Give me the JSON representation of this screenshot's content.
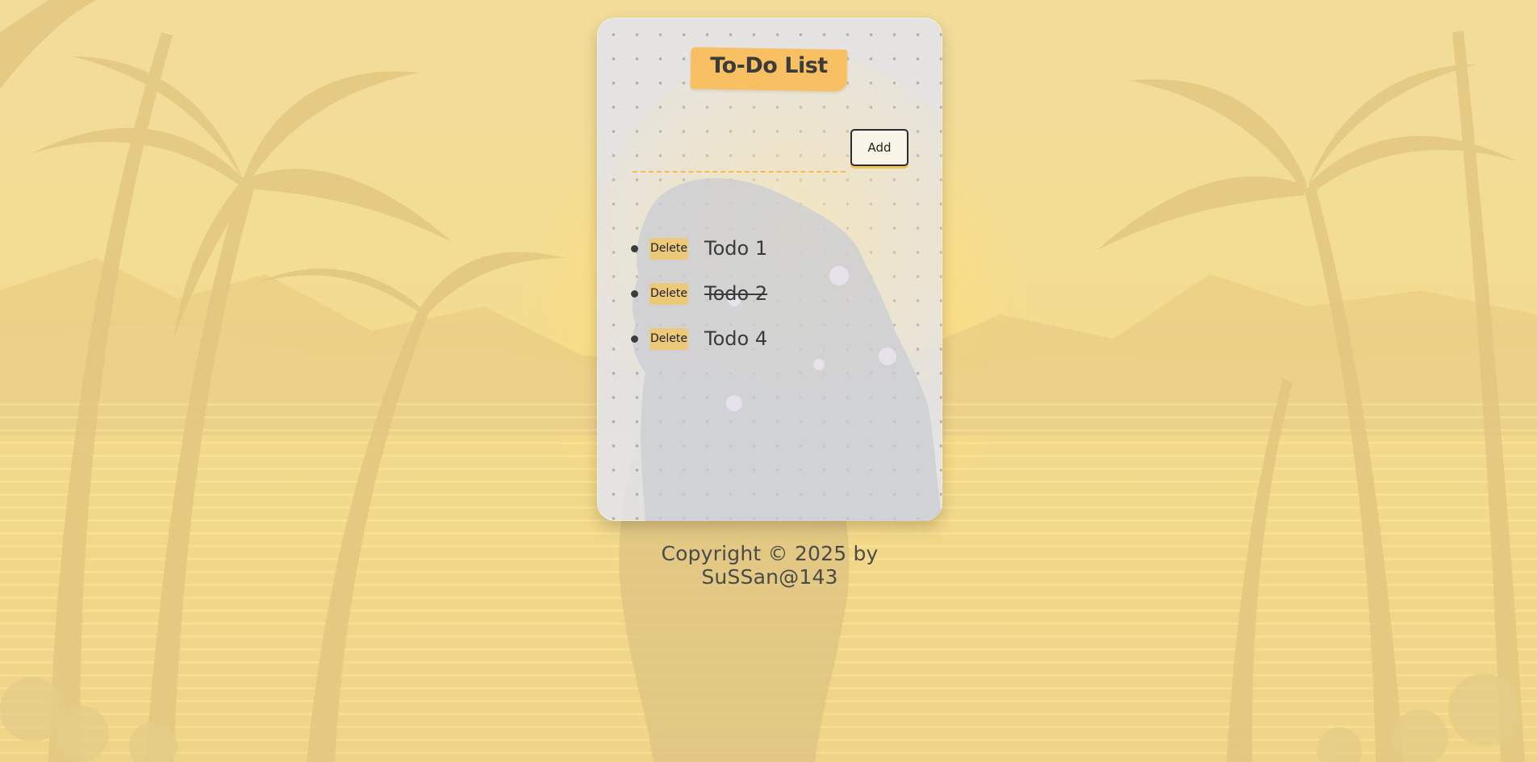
{
  "app": {
    "title": "To-Do List"
  },
  "form": {
    "input_value": "",
    "input_placeholder": "",
    "add_label": "Add"
  },
  "todos": [
    {
      "text": "Todo 1",
      "completed": false,
      "delete_label": "Delete"
    },
    {
      "text": "Todo 2",
      "completed": true,
      "delete_label": "Delete"
    },
    {
      "text": "Todo 4",
      "completed": false,
      "delete_label": "Delete"
    }
  ],
  "footer": {
    "text": "Copyright © 2025 by SuSSan@143"
  },
  "colors": {
    "accent": "#f9c063",
    "input_underline": "#f3bb52",
    "delete_bg": "#ecc978",
    "text": "#3a3a3a"
  }
}
